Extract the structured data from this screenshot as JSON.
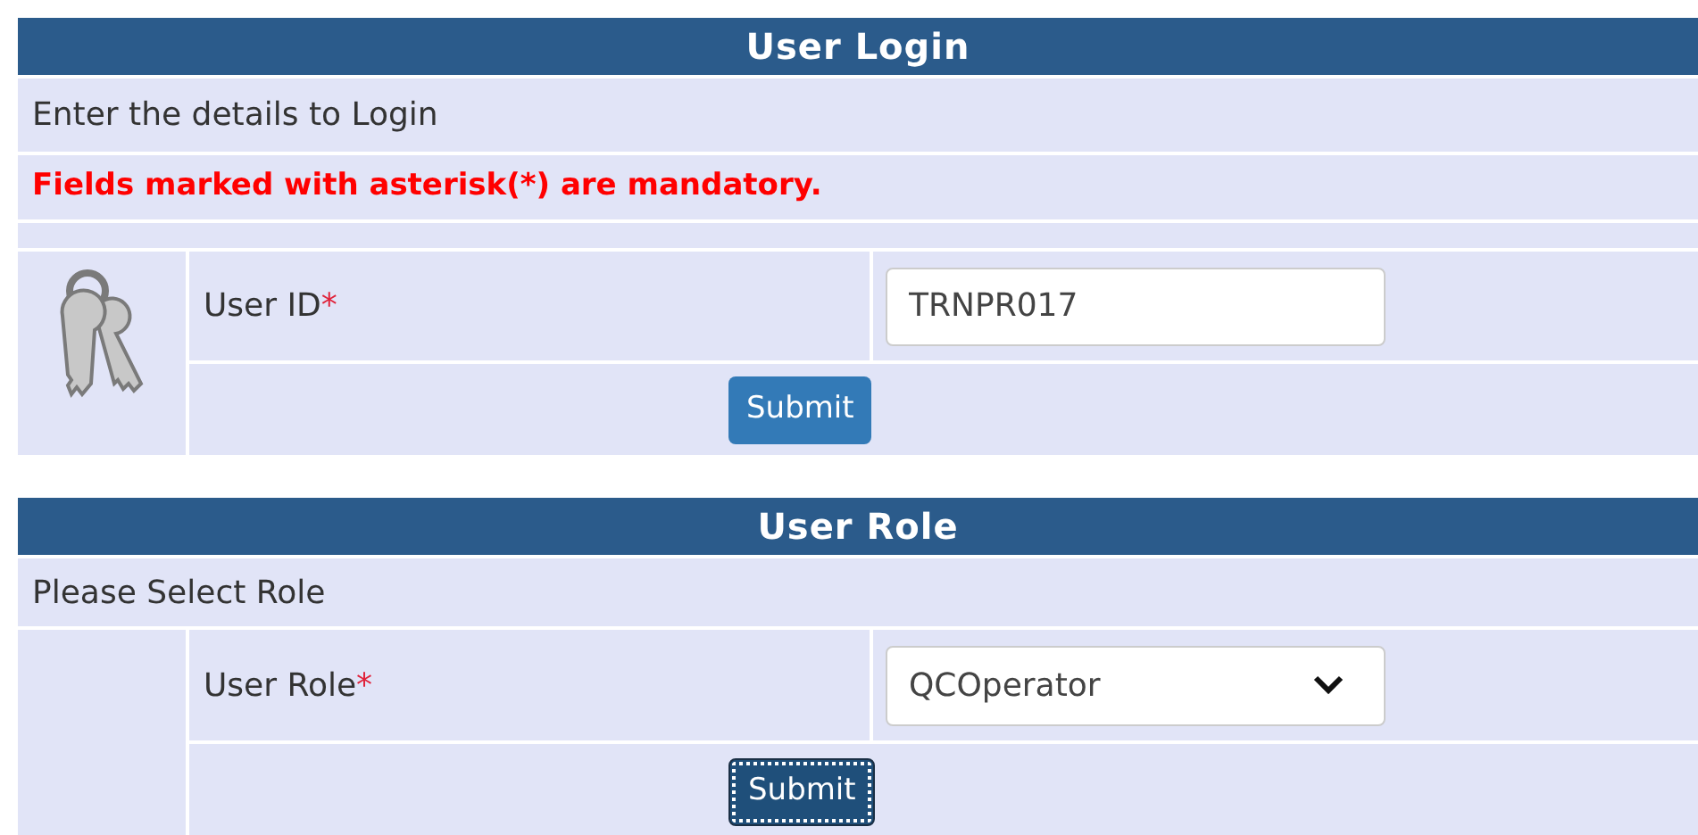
{
  "login": {
    "title": "User Login",
    "intro": "Enter the details to Login",
    "notice": "Fields marked with asterisk(*) are mandatory.",
    "field": {
      "label": "User ID",
      "required_mark": "*",
      "value": "TRNPR017"
    },
    "submit": {
      "label": "Submit",
      "focused": false
    }
  },
  "role": {
    "title": "User Role",
    "intro": "Please Select Role",
    "field": {
      "label": "User Role",
      "required_mark": "*",
      "value": "QCOperator"
    },
    "submit": {
      "label": "Submit",
      "focused": true
    }
  }
}
